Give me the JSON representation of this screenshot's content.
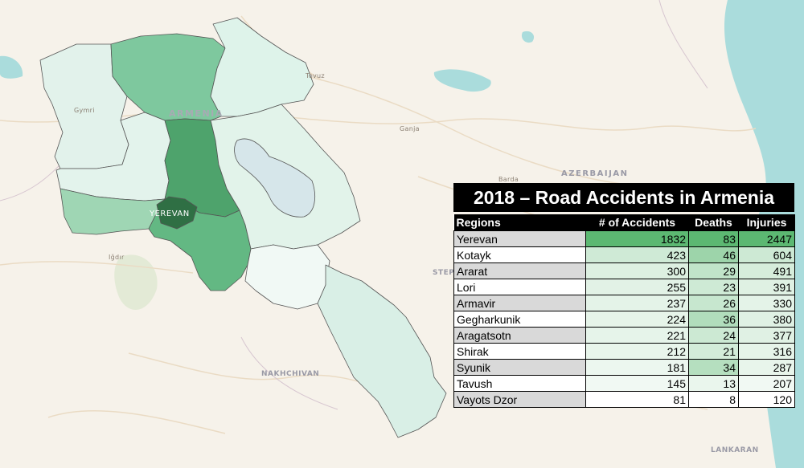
{
  "map": {
    "country_label": "ARMENIA",
    "capital_label": "YEREVAN",
    "place_labels": [
      {
        "name": "Tovuz"
      },
      {
        "name": "Gymri"
      },
      {
        "name": "Ganja"
      },
      {
        "name": "Barda"
      },
      {
        "name": "AZERBAIJAN"
      },
      {
        "name": "Iğdır"
      },
      {
        "name": "NAKHCHIVAN"
      },
      {
        "name": "STEP"
      },
      {
        "name": "LANKARAN"
      }
    ],
    "colors": {
      "lowest": "#f1f9f5",
      "highest": "#2a7a45",
      "capital": "#2f6f44"
    }
  },
  "table": {
    "title": "2018 – Road Accidents in Armenia",
    "columns": [
      "Regions",
      "# of Accidents",
      "Deaths",
      "Injuries"
    ],
    "rows": [
      {
        "region": "Yerevan",
        "accidents": "1832",
        "deaths": "83",
        "injuries": "2447"
      },
      {
        "region": "Kotayk",
        "accidents": "423",
        "deaths": "46",
        "injuries": "604"
      },
      {
        "region": "Ararat",
        "accidents": "300",
        "deaths": "29",
        "injuries": "491"
      },
      {
        "region": "Lori",
        "accidents": "255",
        "deaths": "23",
        "injuries": "391"
      },
      {
        "region": "Armavir",
        "accidents": "237",
        "deaths": "26",
        "injuries": "330"
      },
      {
        "region": "Gegharkunik",
        "accidents": "224",
        "deaths": "36",
        "injuries": "380"
      },
      {
        "region": "Aragatsotn",
        "accidents": "221",
        "deaths": "24",
        "injuries": "377"
      },
      {
        "region": "Shirak",
        "accidents": "212",
        "deaths": "21",
        "injuries": "316"
      },
      {
        "region": "Syunik",
        "accidents": "181",
        "deaths": "34",
        "injuries": "287"
      },
      {
        "region": "Tavush",
        "accidents": "145",
        "deaths": "13",
        "injuries": "207"
      },
      {
        "region": "Vayots Dzor",
        "accidents": "81",
        "deaths": "8",
        "injuries": "120"
      }
    ],
    "colors": {
      "region_shade": "#d9d9d9",
      "heat_high": "#5cb872",
      "heat_low": "#ffffff"
    }
  }
}
